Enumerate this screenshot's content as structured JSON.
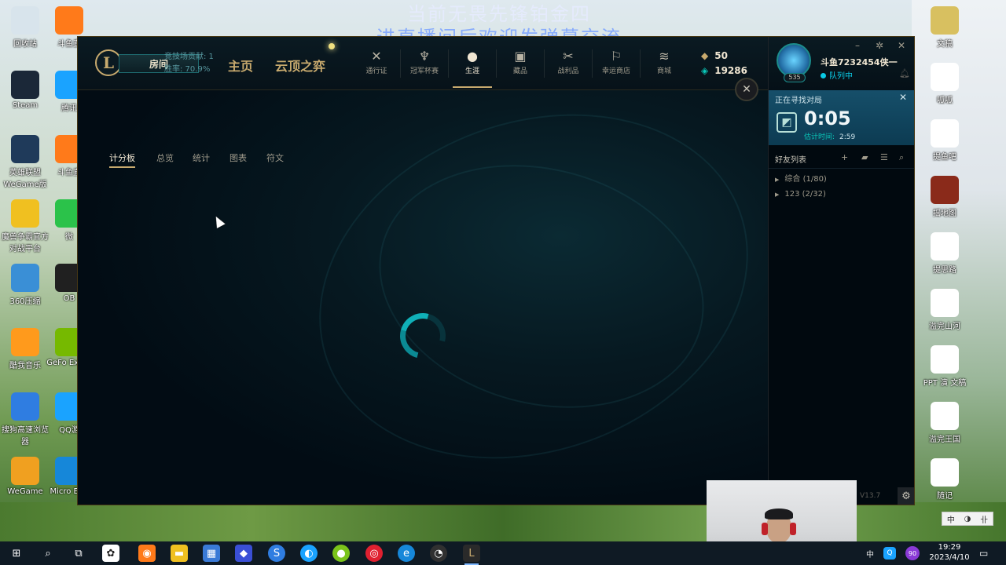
{
  "overlay": {
    "line1": "当前无畏先锋铂金四",
    "line2": "进直播间后欢迎发弹幕交流"
  },
  "desktop_icons_left": [
    {
      "label": "回收站",
      "icon": "recycle-bin-icon",
      "color": "#d8e4ec"
    },
    {
      "label": "Steam",
      "icon": "steam-icon",
      "color": "#1b2838"
    },
    {
      "label": "英雄联盟 WeGame版",
      "icon": "lol-icon",
      "color": "#1f3a5a"
    },
    {
      "label": "魔兽争霸官方对战平台",
      "icon": "warcraft-icon",
      "color": "#f0c020"
    },
    {
      "label": "360压缩",
      "icon": "zip-icon",
      "color": "#3a8fd6"
    },
    {
      "label": "酷我音乐",
      "icon": "music-icon",
      "color": "#ff9a1c"
    },
    {
      "label": "搜狗高速浏览器",
      "icon": "browser-icon",
      "color": "#2f7de1"
    },
    {
      "label": "WeGame",
      "icon": "wegame-icon",
      "color": "#f0a020"
    }
  ],
  "desktop_icons_col2": [
    {
      "label": "斗鱼直",
      "icon": "douyu-icon",
      "color": "#ff7a1a"
    },
    {
      "label": "腾讯",
      "icon": "qq-icon",
      "color": "#1aa3ff"
    },
    {
      "label": "斗鱼直",
      "icon": "douyu-icon",
      "color": "#ff7a1a"
    },
    {
      "label": "微",
      "icon": "wechat-icon",
      "color": "#2bc24a"
    },
    {
      "label": "OB",
      "icon": "obs-icon",
      "color": "#202020"
    },
    {
      "label": "GeFo Exper",
      "icon": "nvidia-icon",
      "color": "#76b900"
    },
    {
      "label": "QQ游",
      "icon": "qqgame-icon",
      "color": "#1aa3ff"
    },
    {
      "label": "Micro Edg",
      "icon": "edge-icon",
      "color": "#1687d9"
    }
  ],
  "desktop_icons_right": [
    {
      "label": "文稿",
      "icon": "folder-icon",
      "color": "#d8c060"
    },
    {
      "label": "呱呱",
      "icon": "app-icon",
      "color": "#ffffff"
    },
    {
      "label": "提鱼吧",
      "icon": "doc-icon",
      "color": "#ffffff"
    },
    {
      "label": "摇地图",
      "icon": "map-icon",
      "color": "#8a2a1a"
    },
    {
      "label": "提思路",
      "icon": "doc-icon",
      "color": "#ffffff"
    },
    {
      "label": "溢完山河",
      "icon": "doc-icon",
      "color": "#ffffff"
    },
    {
      "label": "PPT 演 文稿",
      "icon": "ppt-icon",
      "color": "#ffffff"
    },
    {
      "label": "溢完王国",
      "icon": "doc-icon",
      "color": "#ffffff"
    },
    {
      "label": "随记",
      "icon": "doc-icon",
      "color": "#ffffff"
    }
  ],
  "client": {
    "room_button": "房间",
    "room_info_line1": "竞技场贡献: 1",
    "room_info_line2": "胜率: 70.9%",
    "nav_home": "主页",
    "nav_tft": "云顶之弈",
    "nav_icons": [
      {
        "label": "通行证",
        "icon": "pass-icon",
        "glyph": "✕"
      },
      {
        "label": "冠军杯赛",
        "icon": "clash-icon",
        "glyph": "♆"
      },
      {
        "label": "生涯",
        "icon": "profile-icon",
        "glyph": "●"
      },
      {
        "label": "藏品",
        "icon": "collection-icon",
        "glyph": "▣"
      },
      {
        "label": "战利品",
        "icon": "loot-icon",
        "glyph": "✂"
      },
      {
        "label": "幸运商店",
        "icon": "lucky-shop-icon",
        "glyph": "⚐"
      },
      {
        "label": "商城",
        "icon": "store-icon",
        "glyph": "≋"
      }
    ],
    "active_nav": "生涯",
    "rp": "50",
    "blue_essence": "19286",
    "subtabs": [
      "计分板",
      "总览",
      "统计",
      "图表",
      "符文"
    ],
    "active_subtab": "计分板"
  },
  "social": {
    "summoner_name": "斗鱼7232454侠一",
    "level": "535",
    "status": "队列中",
    "queue_title": "正在寻找对局",
    "queue_timer": "0:05",
    "queue_est_label": "估计时间:",
    "queue_est_value": "2:59",
    "friends_title": "好友列表",
    "groups": [
      "综合 (1/80)",
      "123 (2/32)"
    ],
    "version": "V13.7"
  },
  "ime": {
    "a": "中",
    "b": "◑",
    "c": "卝"
  },
  "taskbar": {
    "tray_lang": "中",
    "clock_time": "19:29",
    "clock_date": "2023/4/10",
    "badge": "90"
  },
  "colors": {
    "gold": "#c8aa6e",
    "teal": "#0ac8b9",
    "client_bg": "#010a13"
  }
}
